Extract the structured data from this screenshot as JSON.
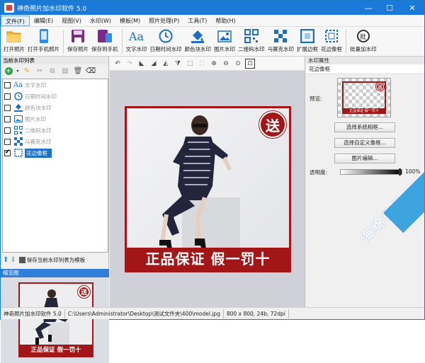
{
  "window": {
    "title": "神奇照片加水印软件 5.0",
    "min": "—",
    "max": "☐",
    "close": "✕"
  },
  "menu": [
    "文件(F)",
    "编辑(E)",
    "视图(V)",
    "水印(W)",
    "模板(M)",
    "照片处理(P)",
    "工具(T)",
    "帮助(H)"
  ],
  "toolbar": [
    "打开照片",
    "打开手机照片",
    "保存照片",
    "保存到手机",
    "文字水印",
    "日期时间水印",
    "颜色块水印",
    "图片水印",
    "二维码水印",
    "马赛克水印",
    "扩展边框",
    "花边像框",
    "批量加水印"
  ],
  "left": {
    "list_title": "当前水印列表",
    "items": [
      {
        "label": "文字水印",
        "checked": false,
        "icon": "text-icon"
      },
      {
        "label": "日期时间水印",
        "checked": false,
        "icon": "clock-icon"
      },
      {
        "label": "颜色块水印",
        "checked": false,
        "icon": "paint-bucket-icon"
      },
      {
        "label": "图片水印",
        "checked": false,
        "icon": "image-icon"
      },
      {
        "label": "二维码水印",
        "checked": false,
        "icon": "qrcode-icon"
      },
      {
        "label": "马赛克水印",
        "checked": false,
        "icon": "mosaic-icon"
      },
      {
        "label": "花边像框",
        "checked": true,
        "icon": "frame-icon"
      }
    ],
    "save_template": "保存当前水印列表为模板",
    "thumb_title": "缩览图"
  },
  "photo": {
    "seal": "送",
    "banner": "正品保证 假一罚十"
  },
  "right": {
    "title": "水印属性",
    "subtitle": "花边像框",
    "preview_label": "预览:",
    "preview_banner": "正品保证 假一罚十",
    "preview_seal": "送",
    "btn_system": "选择系统相框...",
    "btn_custom": "选择自定义像框...",
    "btn_edit": "图片编辑...",
    "opacity_label": "透明度:",
    "opacity_value": "100%",
    "opacity": 1.0
  },
  "status": {
    "app": "神奇照片加水印软件 5.0",
    "path": "C:\\Users\\Administrator\\Desktop\\测试文件夹\\400\\model.jpg",
    "info": "800 x 800, 24b, 72dpi"
  },
  "watermark": {
    "text": "海绵软件"
  },
  "colors": {
    "titlebar": "#1b7ad7",
    "frame": "#a31617",
    "selection": "#1b72c6"
  }
}
